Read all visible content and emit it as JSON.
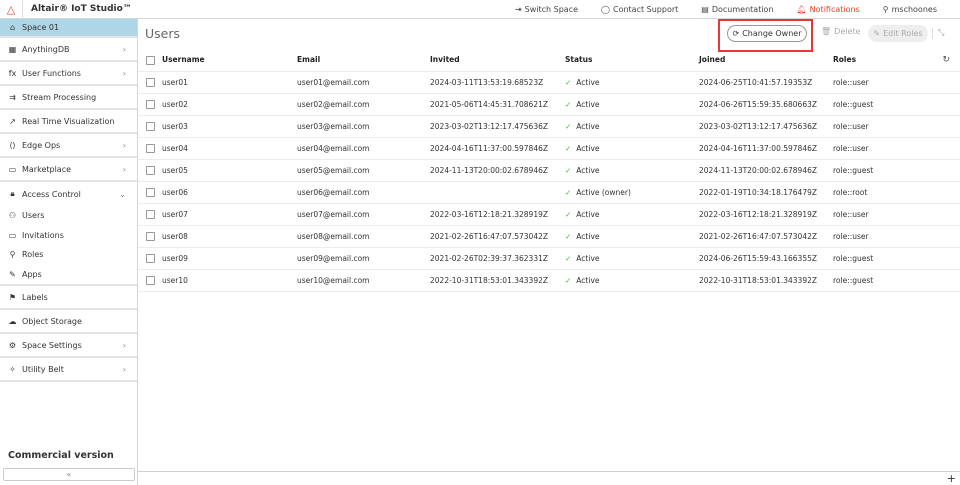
{
  "app": {
    "title": "Altair® IoT Studio™"
  },
  "topnav": [
    {
      "label": "Switch Space",
      "icon": "switch-space-icon",
      "glyph": "⇥"
    },
    {
      "label": "Contact Support",
      "icon": "chat-icon",
      "glyph": "◯"
    },
    {
      "label": "Documentation",
      "icon": "document-icon",
      "glyph": "▤"
    },
    {
      "label": "Notifications",
      "icon": "bell-icon",
      "glyph": "🔔︎"
    },
    {
      "label": "mschoones",
      "icon": "user-icon",
      "glyph": "⚲"
    }
  ],
  "sidebar": {
    "space": "Space 01",
    "items": [
      {
        "label": "AnythingDB",
        "icon": "grid-icon",
        "glyph": "▦",
        "chevron": true
      },
      {
        "label": "User Functions",
        "icon": "function-icon",
        "glyph": "fx",
        "chevron": true
      },
      {
        "label": "Stream Processing",
        "icon": "stream-icon",
        "glyph": "⇉",
        "chevron": false
      },
      {
        "label": "Real Time Visualization",
        "icon": "chart-icon",
        "glyph": "↗",
        "chevron": false
      },
      {
        "label": "Edge Ops",
        "icon": "edge-icon",
        "glyph": "⟨⟩",
        "chevron": true
      },
      {
        "label": "Marketplace",
        "icon": "marketplace-icon",
        "glyph": "▭",
        "chevron": true
      }
    ],
    "access_control": {
      "label": "Access Control",
      "children": [
        {
          "label": "Users",
          "icon": "users-icon",
          "glyph": "⚇"
        },
        {
          "label": "Invitations",
          "icon": "invitation-icon",
          "glyph": "▭"
        },
        {
          "label": "Roles",
          "icon": "roles-icon",
          "glyph": "⚲"
        },
        {
          "label": "Apps",
          "icon": "apps-icon",
          "glyph": "✎"
        }
      ]
    },
    "items2": [
      {
        "label": "Labels",
        "icon": "flag-icon",
        "glyph": "⚑",
        "chevron": false
      },
      {
        "label": "Object Storage",
        "icon": "cloud-icon",
        "glyph": "☁",
        "chevron": false
      },
      {
        "label": "Space Settings",
        "icon": "gear-icon",
        "glyph": "⚙",
        "chevron": true
      },
      {
        "label": "Utility Belt",
        "icon": "pin-icon",
        "glyph": "✧",
        "chevron": true
      }
    ],
    "footer": "Commercial version",
    "collapse": "«"
  },
  "main": {
    "title": "Users",
    "change_owner": "Change Owner",
    "delete": "Delete",
    "edit_roles": "Edit Roles",
    "columns": [
      "Username",
      "Email",
      "Invited",
      "Status",
      "Joined",
      "Roles"
    ],
    "rows": [
      [
        "user01",
        "user01@email.com",
        "2024-03-11T13:53:19.68523Z",
        "Active",
        "2024-06-25T10:41:57.19353Z",
        "role::user"
      ],
      [
        "user02",
        "user02@email.com",
        "2021-05-06T14:45:31.708621Z",
        "Active",
        "2024-06-26T15:59:35.680663Z",
        "role::guest"
      ],
      [
        "user03",
        "user03@email.com",
        "2023-03-02T13:12:17.475636Z",
        "Active",
        "2023-03-02T13:12:17.475636Z",
        "role::user"
      ],
      [
        "user04",
        "user04@email.com",
        "2024-04-16T11:37:00.597846Z",
        "Active",
        "2024-04-16T11:37:00.597846Z",
        "role::user"
      ],
      [
        "user05",
        "user05@email.com",
        "2024-11-13T20:00:02.678946Z",
        "Active",
        "2024-11-13T20:00:02.678946Z",
        "role::guest"
      ],
      [
        "user06",
        "user06@email.com",
        "",
        "Active (owner)",
        "2022-01-19T10:34:18.176479Z",
        "role::root"
      ],
      [
        "user07",
        "user07@email.com",
        "2022-03-16T12:18:21.328919Z",
        "Active",
        "2022-03-16T12:18:21.328919Z",
        "role::user"
      ],
      [
        "user08",
        "user08@email.com",
        "2021-02-26T16:47:07.573042Z",
        "Active",
        "2021-02-26T16:47:07.573042Z",
        "role::user"
      ],
      [
        "user09",
        "user09@email.com",
        "2021-02-26T02:39:37.362331Z",
        "Active",
        "2024-06-26T15:59:43.166355Z",
        "role::guest"
      ],
      [
        "user10",
        "user10@email.com",
        "2022-10-31T18:53:01.343392Z",
        "Active",
        "2022-10-31T18:53:01.343392Z",
        "role::guest"
      ]
    ]
  },
  "colors": {
    "accent": "#e8452c",
    "active_bg": "#aed6e6",
    "highlight": "#e53935",
    "status_ok": "#4caf50"
  }
}
